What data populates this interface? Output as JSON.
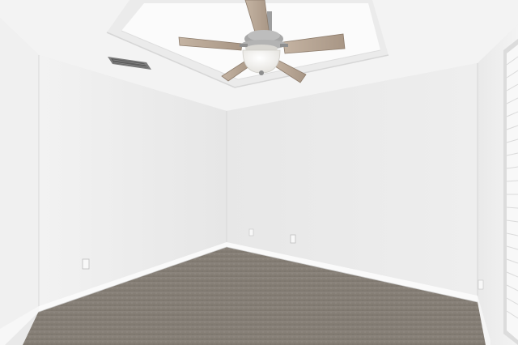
{
  "scene": {
    "subject": "empty-room-photo",
    "elements": [
      "ceiling",
      "tray-ceiling",
      "ceiling-fan",
      "ceiling-light",
      "air-vent",
      "left-wall",
      "back-wall",
      "right-wall",
      "window-blinds",
      "baseboards",
      "electrical-outlets",
      "carpet-floor"
    ],
    "fan_blade_count": 5
  },
  "colors": {
    "ceiling": "#f4f4f4",
    "tray": "#fbfbfb",
    "wall_left": "#efefef",
    "wall_back": "#ececec",
    "wall_right": "#f1f1f1",
    "carpet": "#8e877f",
    "baseboard": "#fafafa",
    "fan_blade": "#b9a898",
    "fan_motor": "#9e9e9e",
    "light_globe": "#fdfdfd",
    "vent": "#7c7c7c",
    "blinds": "#f7f7f7"
  }
}
